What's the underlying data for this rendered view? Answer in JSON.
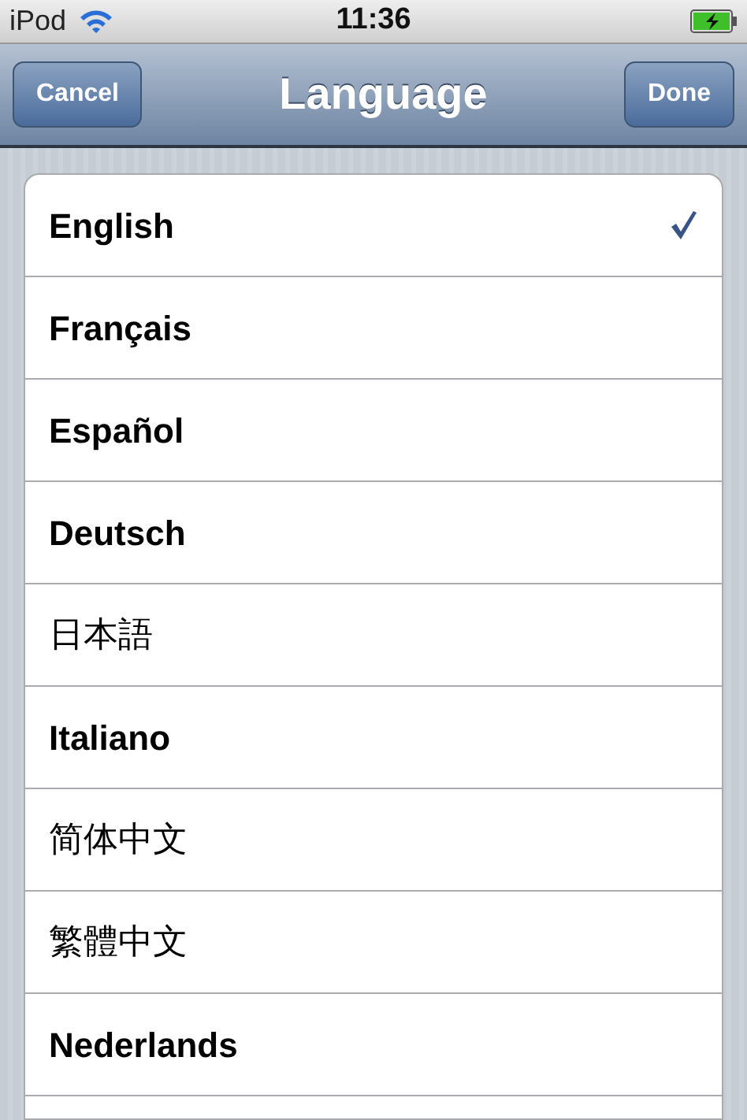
{
  "status_bar": {
    "carrier": "iPod",
    "time": "11:36",
    "charging": true
  },
  "nav_bar": {
    "title": "Language",
    "left_button": "Cancel",
    "right_button": "Done"
  },
  "languages": [
    {
      "label": "English",
      "kind": "latin",
      "selected": true
    },
    {
      "label": "Français",
      "kind": "latin",
      "selected": false
    },
    {
      "label": "Español",
      "kind": "latin",
      "selected": false
    },
    {
      "label": "Deutsch",
      "kind": "latin",
      "selected": false
    },
    {
      "label": "日本語",
      "kind": "cjk",
      "selected": false
    },
    {
      "label": "Italiano",
      "kind": "latin",
      "selected": false
    },
    {
      "label": "简体中文",
      "kind": "cjk",
      "selected": false
    },
    {
      "label": "繁體中文",
      "kind": "cjk",
      "selected": false
    },
    {
      "label": "Nederlands",
      "kind": "latin",
      "selected": false
    }
  ]
}
